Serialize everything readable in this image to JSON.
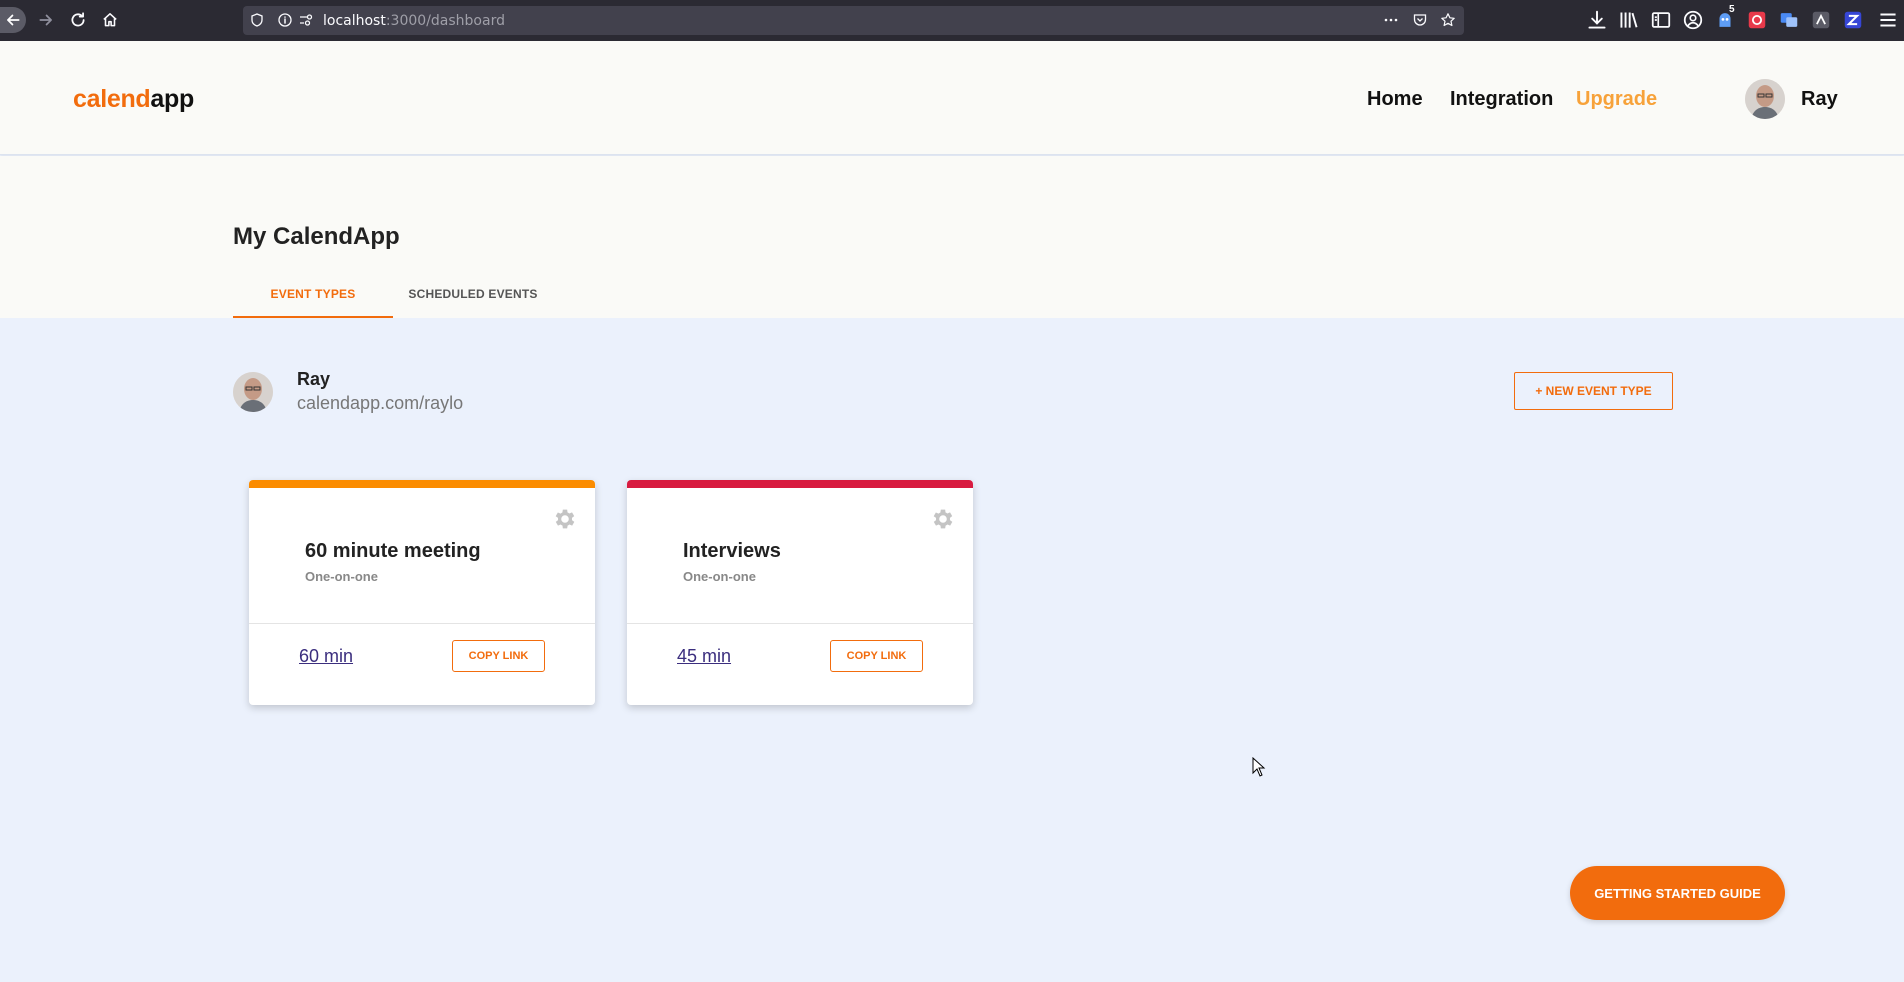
{
  "browser": {
    "url_host": "localhost",
    "url_path": ":3000/dashboard",
    "downloads_badge": "5"
  },
  "header": {
    "logo_part1": "calend",
    "logo_part2": "app",
    "nav": {
      "home": "Home",
      "integration": "Integration",
      "upgrade": "Upgrade"
    },
    "user_name": "Ray"
  },
  "page": {
    "title": "My CalendApp",
    "tabs": {
      "event_types": "EVENT TYPES",
      "scheduled_events": "SCHEDULED EVENTS"
    }
  },
  "profile": {
    "name": "Ray",
    "link": "calendapp.com/raylo",
    "new_event_label": "+ NEW EVENT TYPE"
  },
  "events": [
    {
      "title": "60 minute meeting",
      "type": "One-on-one",
      "duration": "60 min",
      "copy_label": "COPY LINK",
      "color": "#fb8c00"
    },
    {
      "title": "Interviews",
      "type": "One-on-one",
      "duration": "45 min",
      "copy_label": "COPY LINK",
      "color": "#d81b40"
    }
  ],
  "guide_label": "GETTING STARTED GUIDE",
  "colors": {
    "brand": "#f26c0d",
    "upgrade": "#f7a23a",
    "page_bg": "#ebf1fc",
    "header_bg": "#fafaf7"
  },
  "icons": [
    "back-icon",
    "forward-icon",
    "reload-icon",
    "home-icon",
    "shield-icon",
    "info-icon",
    "permissions-icon",
    "more-icon",
    "pocket-icon",
    "star-icon",
    "download-icon",
    "library-icon",
    "sidebar-icon",
    "account-icon",
    "extension-icon",
    "menu-icon",
    "gear-icon"
  ]
}
